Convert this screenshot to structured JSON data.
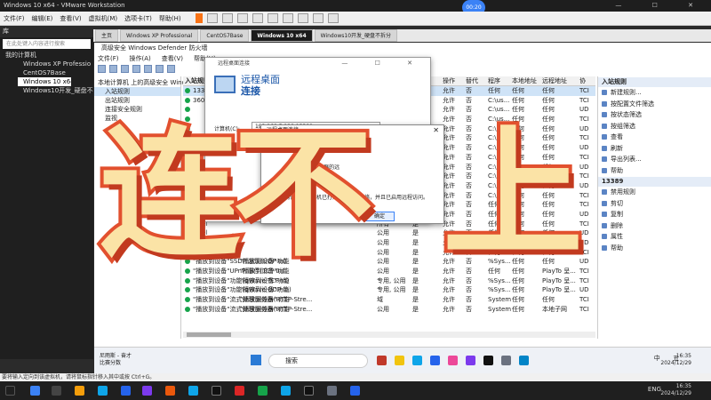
{
  "vm": {
    "title": "Windows 10 x64 - VMware Workstation",
    "recording_time": "00:20",
    "menu": [
      "文件(F)",
      "编辑(E)",
      "查看(V)",
      "虚拟机(M)",
      "选项卡(T)",
      "帮助(H)"
    ],
    "status_text": "要将输入定向到该虚拟机，请将鼠标指针移入其中或按 Ctrl+G。"
  },
  "library": {
    "header": "库",
    "search_placeholder": "在此处键入内容进行搜索",
    "root": "我的计算机",
    "items": [
      "Windows XP Professio",
      "CentOS7Base",
      "Windows 10 x64",
      "Windows10开发_硬盘不"
    ]
  },
  "tabs": [
    "主页",
    "Windows XP Professional",
    "CentOS7Base",
    "Windows 10 x64",
    "Windows10开发_硬盘不拆分"
  ],
  "firewall": {
    "title": "高级安全 Windows Defender 防火墙",
    "menu": [
      "文件(F)",
      "操作(A)",
      "查看(V)",
      "帮助(H)"
    ],
    "tree": [
      "本地计算机 上的高级安全 Windows",
      "入站规则",
      "出站规则",
      "连接安全规则",
      "监视"
    ],
    "grid_title": "入站规则",
    "columns": [
      "操作",
      "替代",
      "程序",
      "本地地址",
      "远程地址",
      "协"
    ],
    "rows": [
      {
        "name": "1338",
        "op": "允许",
        "ov": "否",
        "prog": "任何",
        "local": "任何",
        "remote": "任何",
        "proto": "TCI"
      },
      {
        "name": "360c",
        "op": "允许",
        "ov": "否",
        "prog": "C:\\us...",
        "local": "任何",
        "remote": "任何",
        "proto": "TCI"
      },
      {
        "name": "",
        "op": "允许",
        "ov": "否",
        "prog": "C:\\us...",
        "local": "任何",
        "remote": "任何",
        "proto": "UD"
      },
      {
        "name": "",
        "op": "允许",
        "ov": "否",
        "prog": "C:\\us...",
        "local": "任何",
        "remote": "任何",
        "proto": "TCI"
      },
      {
        "name": "",
        "op": "允许",
        "ov": "否",
        "prog": "C:\\us...",
        "local": "任何",
        "remote": "任何",
        "proto": "UD"
      },
      {
        "name": "",
        "op": "允许",
        "ov": "否",
        "prog": "C:\\us...",
        "local": "任何",
        "remote": "任何",
        "proto": "TCI"
      },
      {
        "name": "",
        "op": "允许",
        "ov": "否",
        "prog": "C:\\us...",
        "local": "任何",
        "remote": "任何",
        "proto": "UD"
      },
      {
        "name": "",
        "op": "允许",
        "ov": "否",
        "prog": "C:\\us...",
        "local": "任何",
        "remote": "任何",
        "proto": "TCI"
      },
      {
        "name": "",
        "op": "允许",
        "ov": "否",
        "prog": "C:\\us...",
        "local": "任何",
        "remote": "任何",
        "proto": "UD"
      },
      {
        "name": "360s",
        "op": "允许",
        "ov": "否",
        "prog": "C:\\us...",
        "local": "任何",
        "remote": "任何",
        "proto": "TCI"
      },
      {
        "name": "360s",
        "op": "允许",
        "ov": "否",
        "prog": "C:\\us...",
        "local": "任何",
        "remote": "任何",
        "proto": "UD"
      },
      {
        "name": "",
        "op": "允许",
        "ov": "否",
        "prog": "C:\\us...",
        "local": "任何",
        "remote": "任何",
        "proto": "TCI"
      },
      {
        "name": "",
        "op": "允许",
        "ov": "否",
        "prog": "任何",
        "local": "任何",
        "remote": "任何",
        "proto": "TCI"
      },
      {
        "name": "",
        "profile": "公用",
        "en": "是",
        "op": "允许",
        "ov": "否",
        "prog": "任何",
        "local": "任何",
        "remote": "任何",
        "proto": "UD"
      },
      {
        "name": "Livel",
        "profile": "所有",
        "en": "是",
        "op": "允许",
        "ov": "否",
        "prog": "任何",
        "local": "任何",
        "remote": "任何",
        "proto": "TCI"
      },
      {
        "name": "Livel",
        "profile": "公用",
        "en": "是",
        "op": "允许",
        "ov": "否",
        "prog": "任何",
        "local": "任何",
        "remote": "任何",
        "proto": "UD"
      },
      {
        "name": "",
        "profile": "公用",
        "en": "是",
        "op": "允许",
        "ov": "否",
        "prog": "任何",
        "local": "任何",
        "remote": "任何",
        "proto": "UD"
      },
      {
        "name": "",
        "profile": "公用",
        "en": "是",
        "op": "允许",
        "ov": "否",
        "prog": "任何",
        "local": "任何",
        "remote": "任何",
        "proto": "TCI"
      },
      {
        "name": "\"播放到设备\"SSDP 发现(UDP-In)",
        "group": "\"播放到设备\"功能",
        "profile": "公用",
        "en": "是",
        "op": "允许",
        "ov": "否",
        "prog": "%Sys...",
        "local": "任何",
        "remote": "任何",
        "proto": "UD"
      },
      {
        "name": "\"播放到设备\"UPnP 事件(TCP-In)",
        "group": "\"播放到设备\"功能",
        "profile": "公用",
        "en": "是",
        "op": "允许",
        "ov": "否",
        "prog": "任何",
        "local": "任何",
        "remote": "PlayTo 呈...",
        "proto": "TCI"
      },
      {
        "name": "\"播放到设备\"功能(qWave-TCP-In)",
        "group": "\"播放到设备\"功能",
        "profile": "专用, 公用",
        "en": "是",
        "op": "允许",
        "ov": "否",
        "prog": "%Sys...",
        "local": "任何",
        "remote": "PlayTo 呈...",
        "proto": "TCI"
      },
      {
        "name": "\"播放到设备\"功能(qWave-UDP-In)",
        "group": "\"播放到设备\"功能",
        "profile": "专用, 公用",
        "en": "是",
        "op": "允许",
        "ov": "否",
        "prog": "%Sys...",
        "local": "任何",
        "remote": "PlayTo 呈...",
        "proto": "UD"
      },
      {
        "name": "\"播放到设备\"流式处理服务器(HTTP-Stre...",
        "group": "\"播放到设备\"功能",
        "profile": "域",
        "en": "是",
        "op": "允许",
        "ov": "否",
        "prog": "System",
        "local": "任何",
        "remote": "任何",
        "proto": "TCI"
      },
      {
        "name": "\"播放到设备\"流式处理服务器(HTTP-Stre...",
        "group": "\"播放到设备\"功能",
        "profile": "公用",
        "en": "是",
        "op": "允许",
        "ov": "否",
        "prog": "System",
        "local": "任何",
        "remote": "本地子网",
        "proto": "TCI"
      }
    ],
    "actions": {
      "section1": "入站规则",
      "items1": [
        "新建规则...",
        "按配置文件筛选",
        "按状态筛选",
        "按组筛选",
        "查看",
        "刷新",
        "导出列表...",
        "帮助"
      ],
      "section2": "13389",
      "items2": [
        "禁用规则",
        "剪切",
        "复制",
        "删除",
        "属性",
        "帮助"
      ]
    }
  },
  "rdp": {
    "title": "远程桌面连接",
    "heading1": "远程桌面",
    "heading2": "连接",
    "computer_label": "计算机(C):",
    "computer_value": "192.168.5.128:13389"
  },
  "error": {
    "title": "远程桌面连接",
    "lines": [
      "1) 未启用对服务器的远",
      "2) 远程计算机已关闭",
      "3) 远程计算机在网"
    ],
    "footer": "确保远程计算机已打开并连接到网络，并且已启用远程访问。",
    "ok": "确定"
  },
  "overlay": {
    "char1": "连",
    "char2": "不",
    "char3": "上",
    "color_fill": "#fbe3a6",
    "color_stroke": "#e2502e"
  },
  "guest_taskbar": {
    "weather_name": "尼雨斯 - 奋才",
    "weather_desc": "比赛分数",
    "search": "搜索",
    "tray": "中 五",
    "time": "16:35",
    "date": "2024/12/29"
  },
  "host_taskbar": {
    "lang": "ENG",
    "time": "16:35",
    "date": "2024/12/29"
  }
}
